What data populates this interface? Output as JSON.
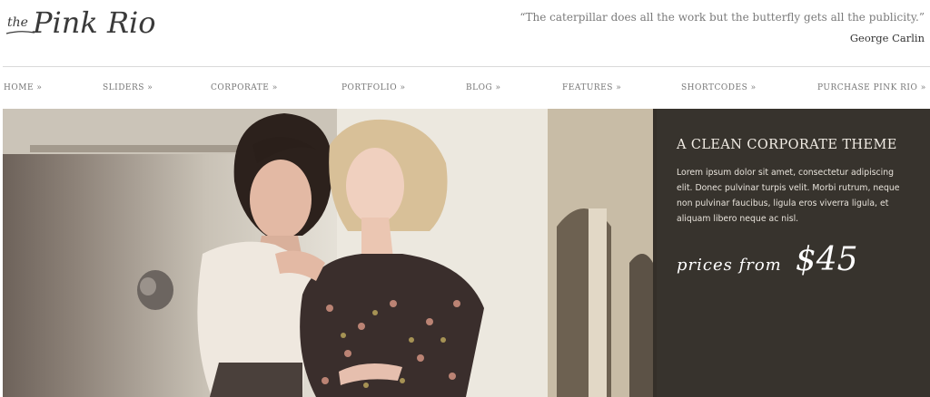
{
  "logo": {
    "small": "the",
    "main": "Pink Rio"
  },
  "quote": {
    "text": "“The caterpillar does all the work but the butterfly gets all the publicity.”",
    "author": "George Carlin"
  },
  "nav": [
    {
      "label": "HOME »"
    },
    {
      "label": "SLIDERS »"
    },
    {
      "label": "CORPORATE »"
    },
    {
      "label": "PORTFOLIO »"
    },
    {
      "label": "BLOG »"
    },
    {
      "label": "FEATURES »"
    },
    {
      "label": "SHORTCODES »"
    },
    {
      "label": "PURCHASE PINK RIO »"
    }
  ],
  "hero": {
    "title": "A CLEAN CORPORATE THEME",
    "body": "Lorem ipsum dolor sit amet, consectetur adipiscing elit. Donec pulvinar turpis velit. Morbi rutrum, neque non pulvinar faucibus, ligula eros viverra ligula, et aliquam libero neque ac nisl.",
    "price_label": "prices from",
    "price_value": "$45"
  },
  "colors": {
    "panel": "#14100e",
    "text_light": "#f3eee6"
  }
}
